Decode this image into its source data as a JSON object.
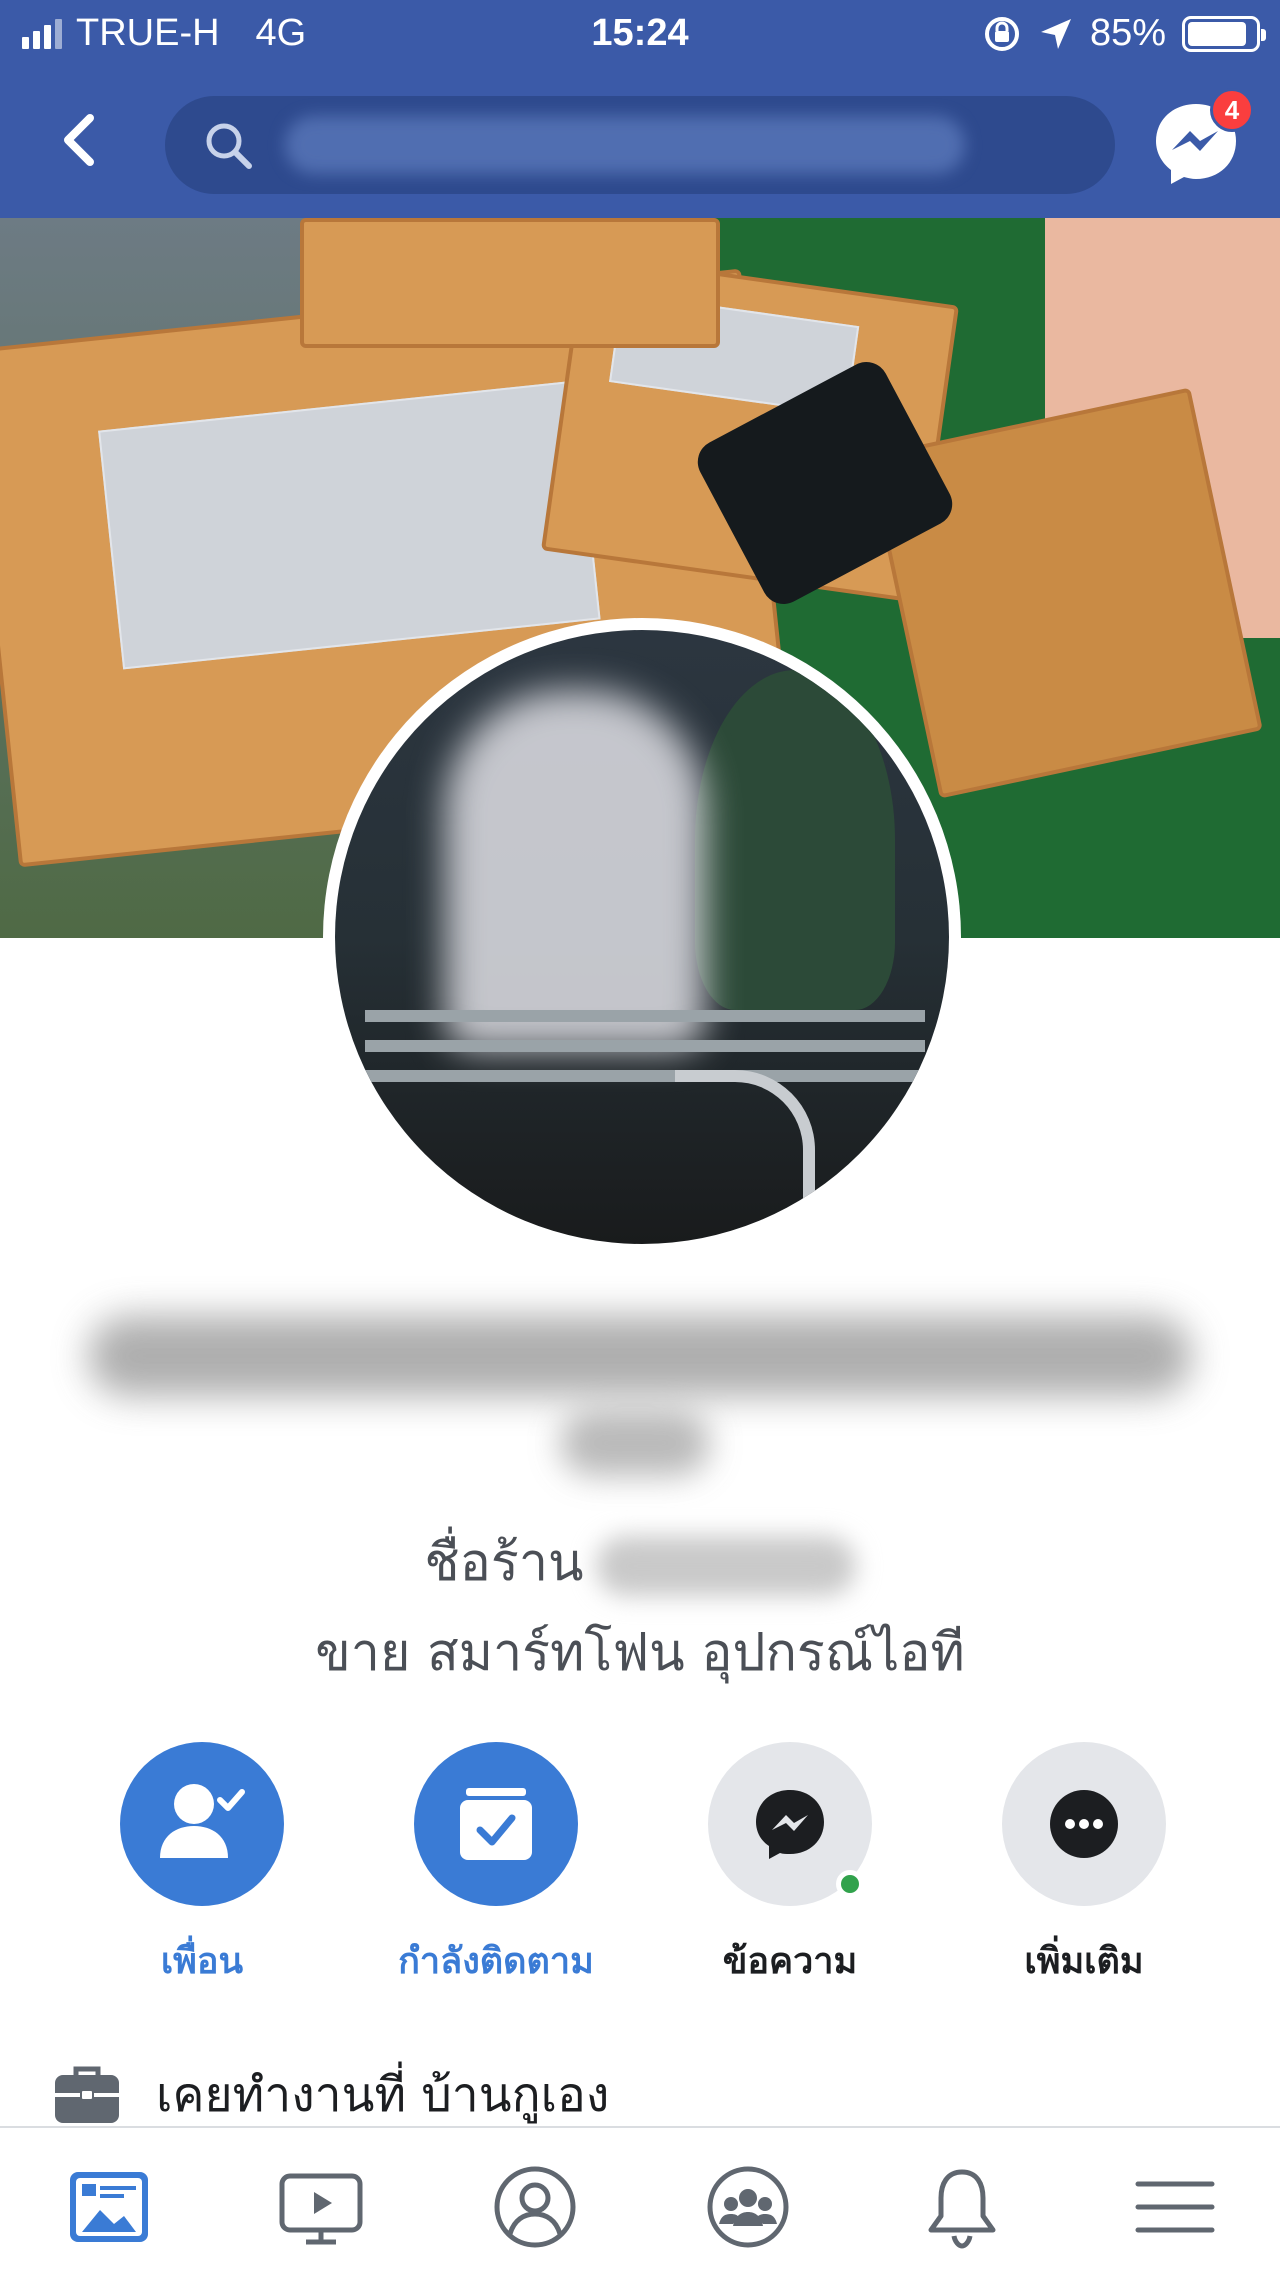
{
  "status_bar": {
    "carrier": "TRUE-H",
    "network": "4G",
    "time": "15:24",
    "battery": "85%"
  },
  "nav": {
    "messenger_badge": "4"
  },
  "profile": {
    "bio_line1": "ชื่อร้าน",
    "bio_line2": "ขาย สมาร์ทโฟน อุปกรณ์ไอที"
  },
  "actions": [
    {
      "label": "เพื่อน",
      "icon": "friends-check-icon"
    },
    {
      "label": "กำลังติดตาม",
      "icon": "following-icon"
    },
    {
      "label": "ข้อความ",
      "icon": "messenger-icon"
    },
    {
      "label": "เพิ่มเติม",
      "icon": "more-icon"
    }
  ],
  "work": {
    "text": "เคยทำงานที่ บ้านกูเอง",
    "icon": "briefcase-icon"
  },
  "tabbar": [
    "news-feed-icon",
    "watch-icon",
    "profile-icon",
    "groups-icon",
    "notifications-icon",
    "menu-icon"
  ],
  "colors": {
    "header_blue": "#3b5aa8",
    "action_blue": "#3a7bd5",
    "badge_red": "#fa3e3e",
    "online_green": "#31a24c"
  }
}
